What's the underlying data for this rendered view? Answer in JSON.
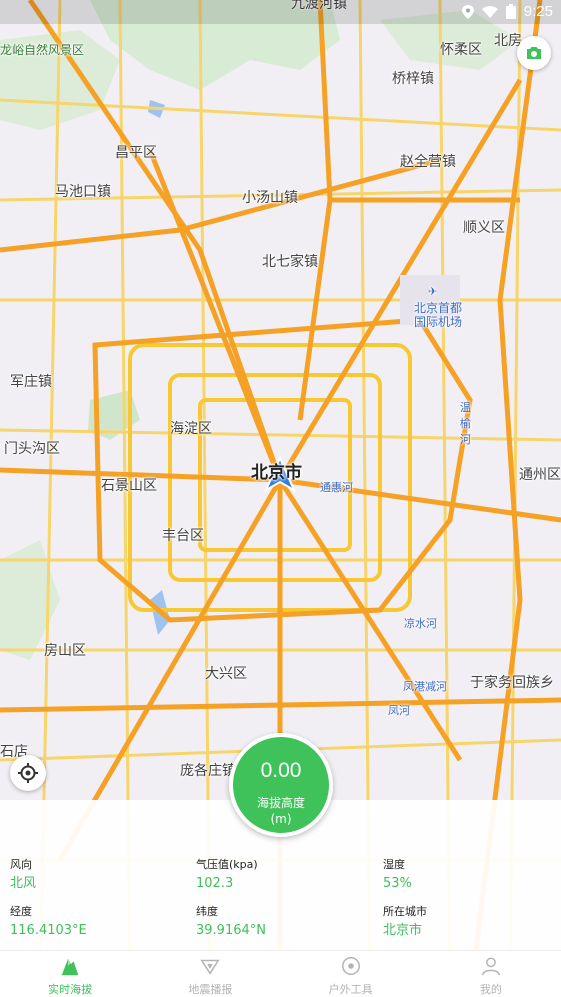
{
  "status_bar": {
    "time": "9:25"
  },
  "map": {
    "labels": {
      "jiudu_river_town": "九渡河镇",
      "natural_scenic": "龙峪自然风景区",
      "huairou_district": "怀柔区",
      "beifang": "北房",
      "qiaozi_town": "桥梓镇",
      "changping_district": "昌平区",
      "zhaoquanying_town": "赵全营镇",
      "machikou_town": "马池口镇",
      "xiaotangshan_town": "小汤山镇",
      "shunyi_district": "顺义区",
      "beiqijia_town": "北七家镇",
      "airport": "北京首都\n国际机场",
      "junzhuang_town": "军庄镇",
      "haidian_district": "海淀区",
      "wenyu_river": "温榆河",
      "mentougou_district": "门头沟区",
      "beijing_city": "北京市",
      "tonghui_river": "通惠河",
      "tongzhou_district": "通州区",
      "shijingshan_district": "石景山区",
      "fengtai_district": "丰台区",
      "liangshui_river": "凉水河",
      "fangshan_district": "房山区",
      "daxing_district": "大兴区",
      "yujiawu_township": "于家务回族乡",
      "fenggang_river": "凤港减河",
      "feng_river": "凤河",
      "panggezhuang_town": "庞各庄镇",
      "shidian": "石店"
    }
  },
  "altitude": {
    "value": "0.00",
    "label": "海拔高度",
    "unit": "(m)"
  },
  "stats": [
    {
      "key": "风向",
      "value": "北风"
    },
    {
      "key": "气压值(kpa)",
      "value": "102.3"
    },
    {
      "key": "湿度",
      "value": "53%"
    },
    {
      "key": "经度",
      "value": "116.4103°E"
    },
    {
      "key": "纬度",
      "value": "39.9164°N"
    },
    {
      "key": "所在城市",
      "value": "北京市"
    }
  ],
  "tabs": [
    {
      "label": "实时海拔",
      "icon": "mountain-icon"
    },
    {
      "label": "地震播报",
      "icon": "triangle-icon"
    },
    {
      "label": "户外工具",
      "icon": "compass-icon"
    },
    {
      "label": "我的",
      "icon": "person-icon"
    }
  ],
  "colors": {
    "accent": "#3fc25a",
    "road_major": "#f4a125",
    "road_minor": "#f7d56a",
    "water": "#9ec3ee",
    "park": "#cfe6cd"
  }
}
